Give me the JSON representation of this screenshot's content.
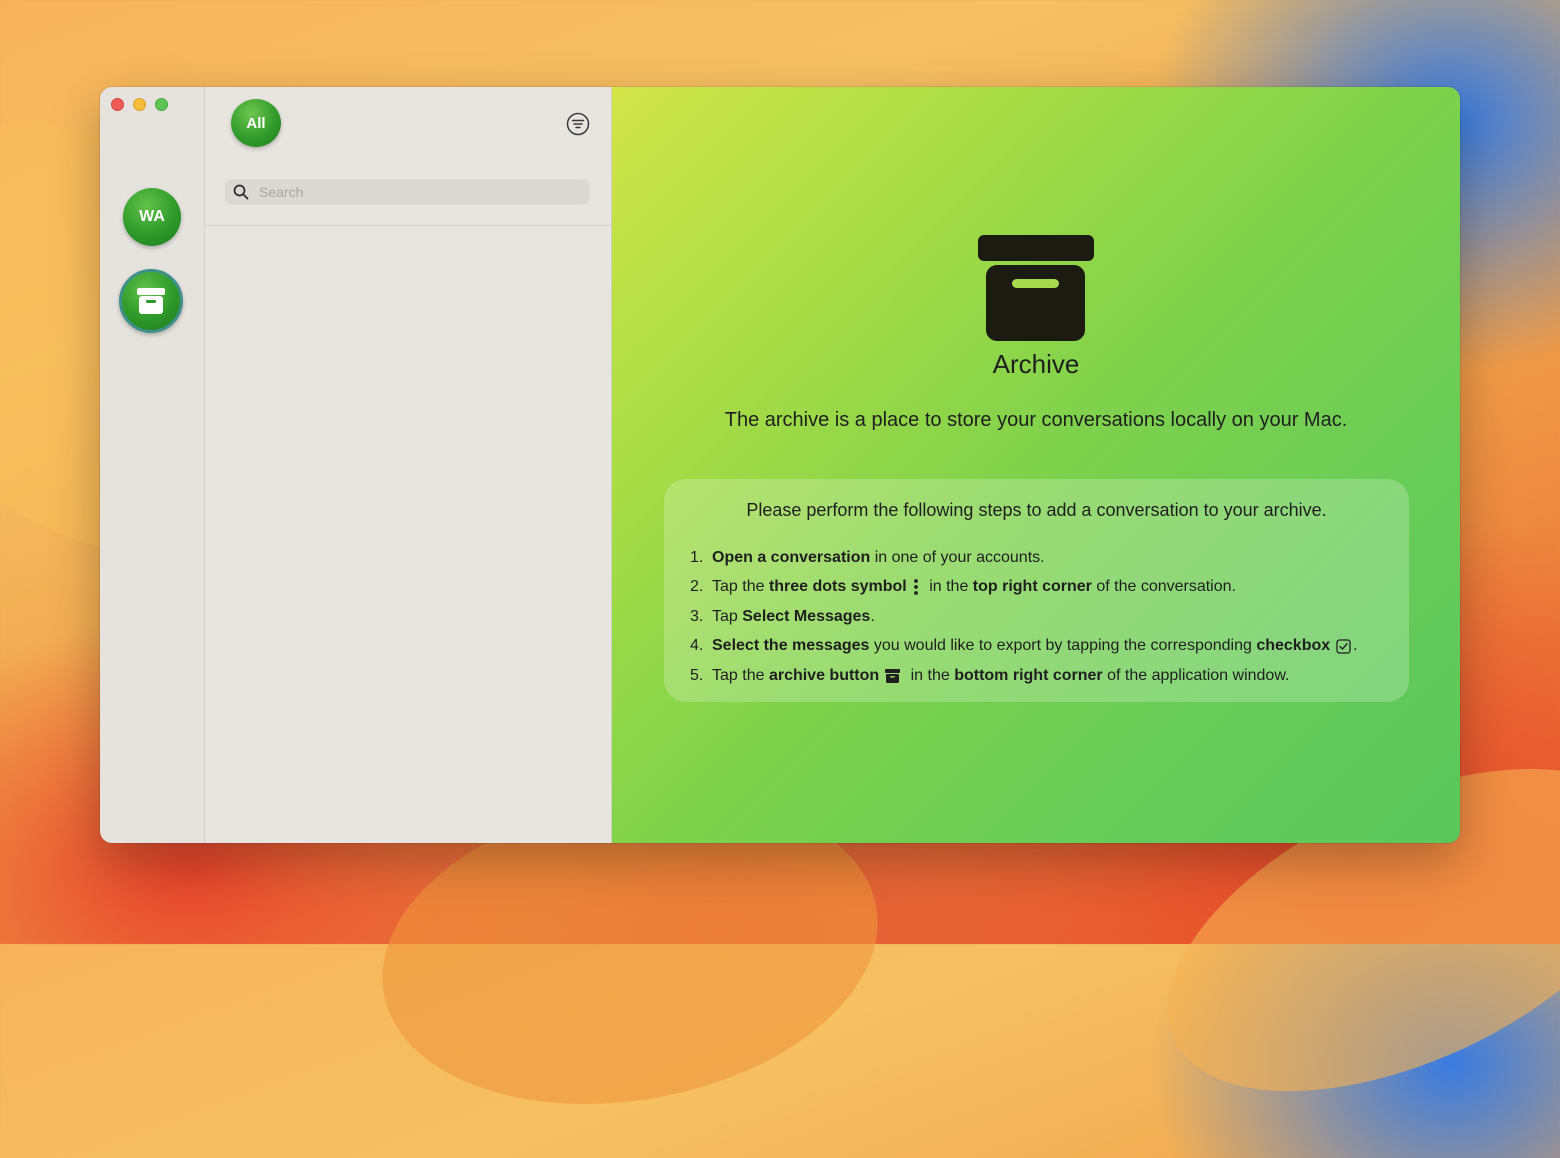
{
  "rail": {
    "accounts": [
      {
        "label": "WA"
      }
    ]
  },
  "list": {
    "all_label": "All",
    "search_placeholder": "Search"
  },
  "main": {
    "title": "Archive",
    "subtitle": "The archive is a place to store your conversations locally on your Mac.",
    "steps_heading": "Please perform the following steps to add a conversation to your archive.",
    "steps": [
      {
        "num": "1.",
        "b1": "Open a conversation",
        "t1": " in one of your accounts."
      },
      {
        "num": "2.",
        "t0": "Tap the ",
        "b1": "three dots symbol",
        "t1": " in the ",
        "b2": "top right corner",
        "t2": " of the conversation."
      },
      {
        "num": "3.",
        "t0": "Tap ",
        "b1": "Select Messages",
        "t1": "."
      },
      {
        "num": "4.",
        "b1": "Select the messages",
        "t1": " you would like to export by tapping the corresponding ",
        "b2": "checkbox",
        "t2": "."
      },
      {
        "num": "5.",
        "t0": "Tap the ",
        "b1": "archive button",
        "t1": " in the ",
        "b2": "bottom right corner",
        "t2": " of the application window."
      }
    ]
  },
  "colors": {
    "accent_green": "#2f9a2a",
    "content_gradient_start": "#d2e549",
    "content_gradient_end": "#5ac75c"
  },
  "icons": [
    "search-icon",
    "filter-icon",
    "archive-icon",
    "three-dots-icon",
    "checkbox-icon"
  ]
}
